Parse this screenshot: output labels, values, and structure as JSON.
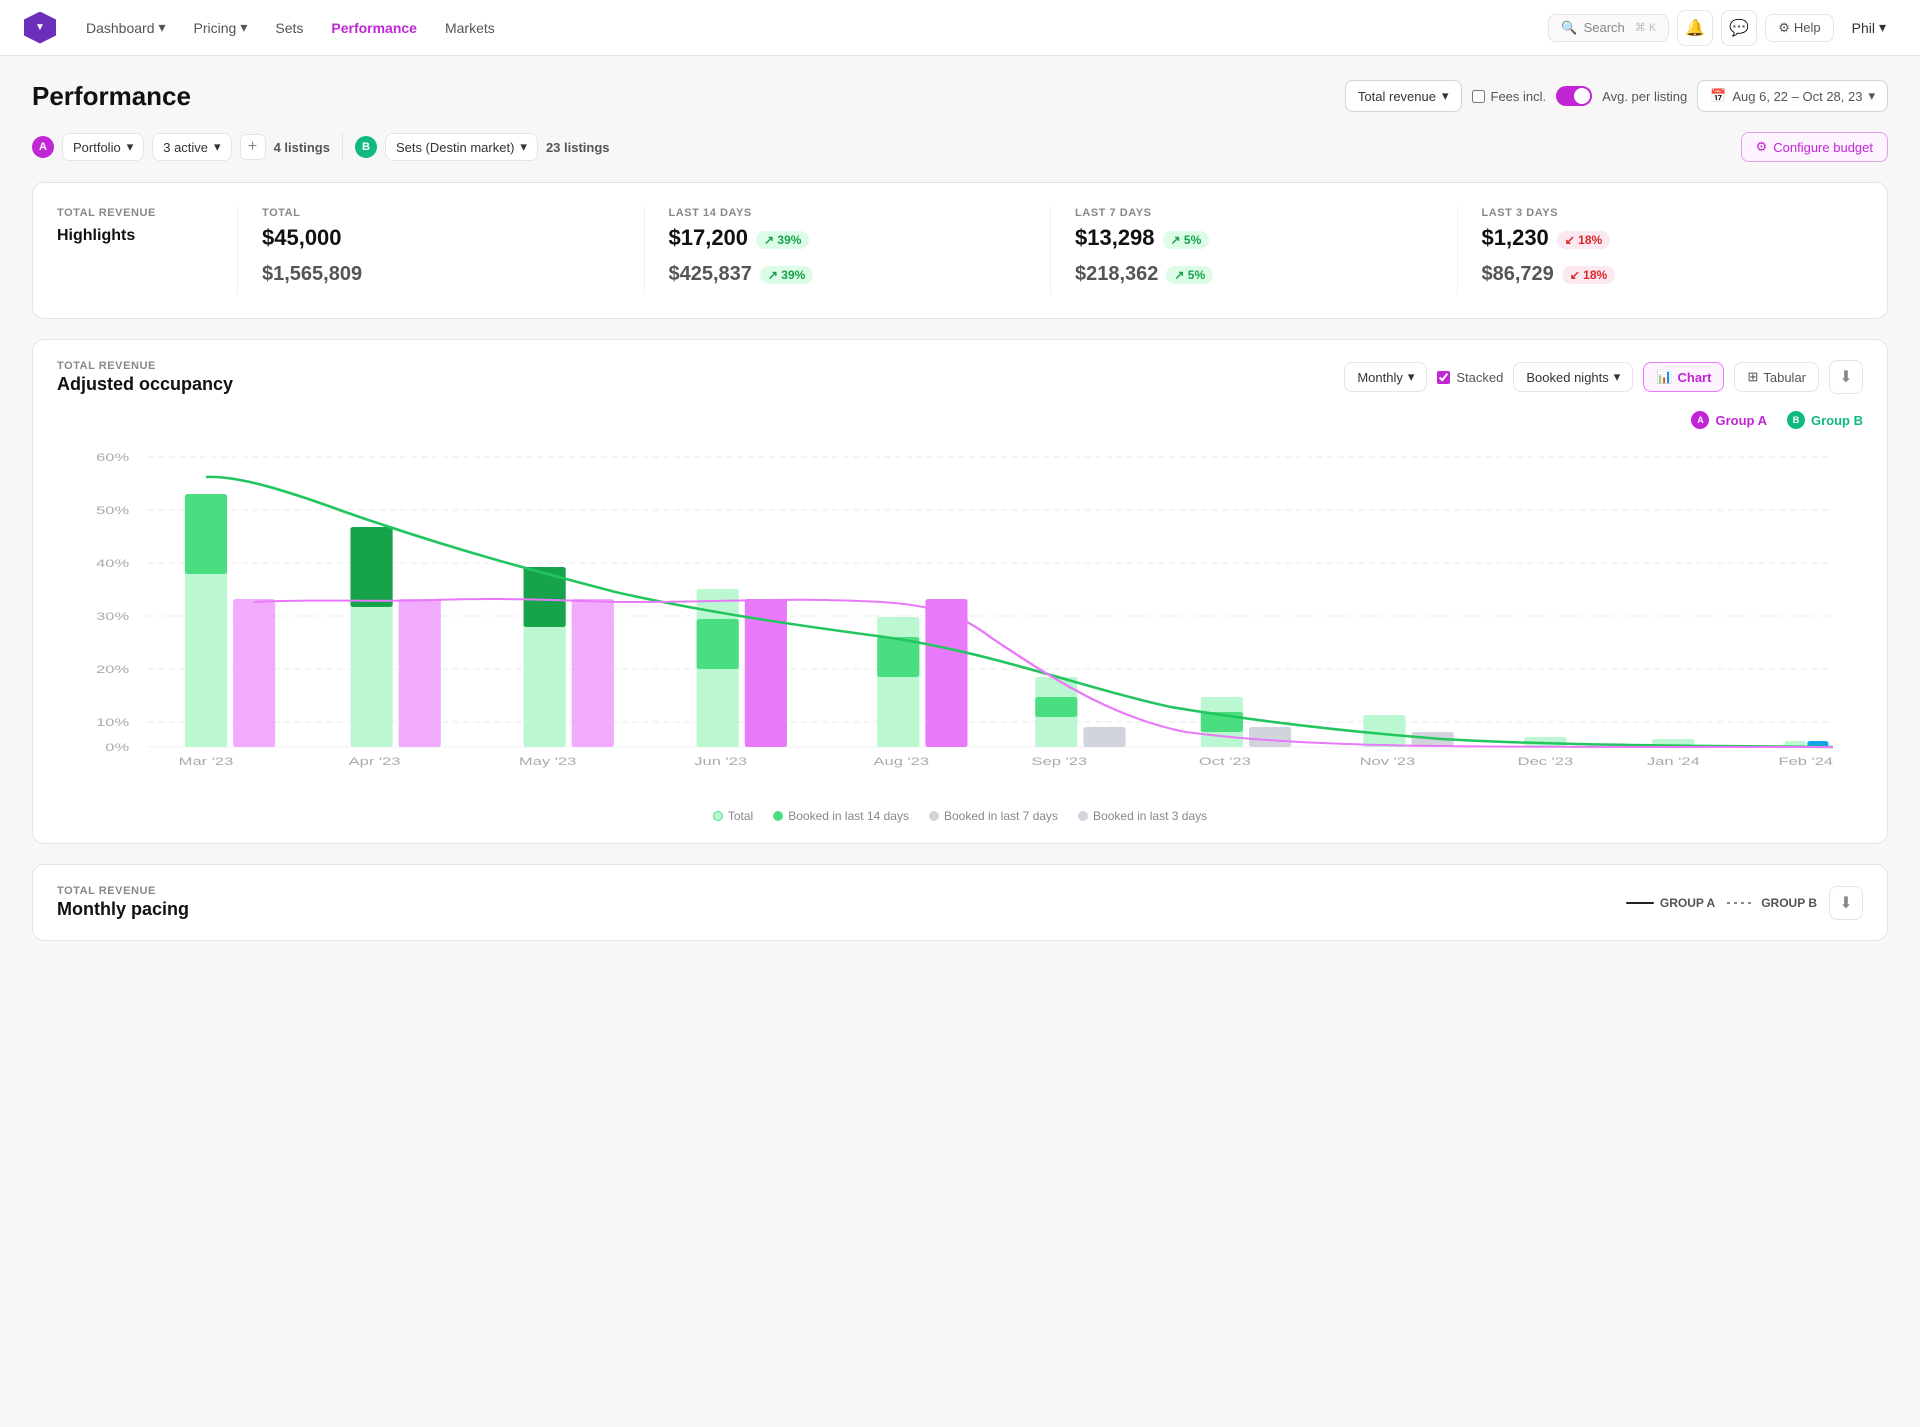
{
  "nav": {
    "logo_alt": "Wheelhouse logo",
    "items": [
      {
        "label": "Dashboard",
        "has_dropdown": true,
        "active": false
      },
      {
        "label": "Pricing",
        "has_dropdown": true,
        "active": false
      },
      {
        "label": "Sets",
        "has_dropdown": false,
        "active": false
      },
      {
        "label": "Performance",
        "has_dropdown": false,
        "active": true
      },
      {
        "label": "Markets",
        "has_dropdown": false,
        "active": false
      }
    ],
    "search_placeholder": "Search",
    "search_shortcut": "⌘ K",
    "help_label": "Help",
    "user_label": "Phil"
  },
  "page": {
    "title": "Performance",
    "header_controls": {
      "metric_dropdown": "Total revenue",
      "fees_label": "Fees incl.",
      "avg_per_listing_label": "Avg. per listing",
      "date_range": "Aug 6, 22 – Oct 28, 23"
    },
    "filter_bar": {
      "group_a_label": "A",
      "group_a_color": "#c026d3",
      "portfolio_label": "Portfolio",
      "active_label": "3 active",
      "add_label": "+",
      "portfolio_count": "4 listings",
      "group_b_label": "B",
      "group_b_color": "#10b981",
      "sets_label": "Sets (Destin market)",
      "sets_count": "23 listings",
      "configure_budget": "Configure budget"
    },
    "highlights": {
      "section_label": "TOTAL REVENUE",
      "section_title": "Highlights",
      "columns": [
        {
          "header": "TOTAL",
          "value": "$45,000",
          "sub_value": "$1,565,809",
          "badge": null
        },
        {
          "header": "LAST 14 DAYS",
          "value": "$17,200",
          "badge_up": "↗ 39%",
          "sub_value": "$425,837",
          "sub_badge_up": "↗ 39%"
        },
        {
          "header": "LAST 7 DAYS",
          "value": "$13,298",
          "badge_up": "↗ 5%",
          "sub_value": "$218,362",
          "sub_badge_up": "↗ 5%"
        },
        {
          "header": "LAST 3 DAYS",
          "value": "$1,230",
          "badge_down": "↙ 18%",
          "sub_value": "$86,729",
          "sub_badge_down": "↙ 18%"
        }
      ]
    },
    "chart": {
      "section_label": "TOTAL REVENUE",
      "title": "Adjusted occupancy",
      "period_label": "Monthly",
      "stacked_label": "Stacked",
      "nights_dropdown": "Booked nights",
      "chart_btn": "Chart",
      "tabular_btn": "Tabular",
      "group_a": "Group A",
      "group_b": "Group B",
      "x_labels": [
        "Mar '23",
        "Apr '23",
        "May '23",
        "Jun '23",
        "Aug '23",
        "Sep '23",
        "Oct '23",
        "Nov '23",
        "Dec '23",
        "Jan '24",
        "Feb '24"
      ],
      "y_labels": [
        "60%",
        "50%",
        "40%",
        "30%",
        "20%",
        "10%",
        "0%"
      ],
      "legend": [
        {
          "label": "Total",
          "color": "#86efac",
          "type": "dot"
        },
        {
          "label": "Booked in last 14 days",
          "color": "#4ade80",
          "type": "dot"
        },
        {
          "label": "Booked in last 7 days",
          "color": "#d1d5db",
          "type": "dot"
        },
        {
          "label": "Booked in last 3 days",
          "color": "#d1d5db",
          "type": "dot"
        }
      ]
    },
    "monthly_pacing": {
      "section_label": "TOTAL REVENUE",
      "title": "Monthly pacing",
      "group_a_label": "GROUP A",
      "group_b_label": "GROUP B"
    }
  }
}
